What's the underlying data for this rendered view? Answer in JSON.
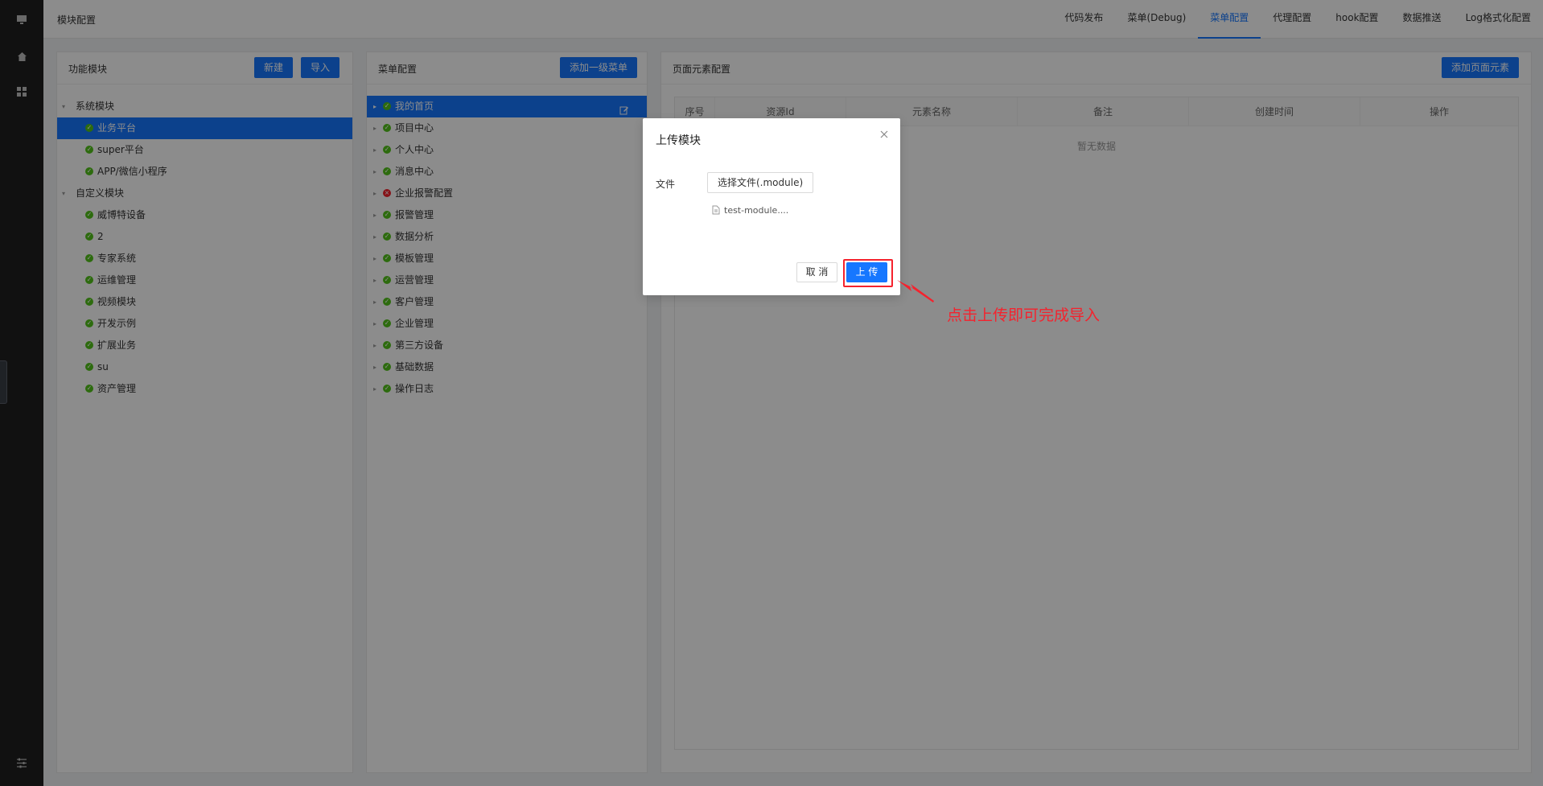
{
  "topbar": {
    "page_title": "模块配置",
    "tabs": [
      {
        "label": "代码发布",
        "active": false
      },
      {
        "label": "菜单(Debug)",
        "active": false
      },
      {
        "label": "菜单配置",
        "active": true
      },
      {
        "label": "代理配置",
        "active": false
      },
      {
        "label": "hook配置",
        "active": false
      },
      {
        "label": "数据推送",
        "active": false
      },
      {
        "label": "Log格式化配置",
        "active": false
      }
    ]
  },
  "sidebar": {
    "icons": [
      "monitor-icon",
      "home-icon",
      "grid-icon",
      "sliders-icon"
    ]
  },
  "module_panel": {
    "title": "功能模块",
    "new_label": "新建",
    "import_label": "导入",
    "groups": [
      {
        "label": "系统模块",
        "items": [
          "业务平台",
          "super平台",
          "APP/微信小程序"
        ]
      },
      {
        "label": "自定义模块",
        "items": [
          "威博特设备",
          "2",
          "专家系统",
          "运维管理",
          "视频模块",
          "开发示例",
          "扩展业务",
          "su",
          "资产管理"
        ]
      }
    ],
    "selected": "业务平台"
  },
  "menu_panel": {
    "title": "菜单配置",
    "add_label": "添加一级菜单",
    "items": [
      {
        "label": "我的首页",
        "status": "ok"
      },
      {
        "label": "项目中心",
        "status": "ok"
      },
      {
        "label": "个人中心",
        "status": "ok"
      },
      {
        "label": "消息中心",
        "status": "ok"
      },
      {
        "label": "企业报警配置",
        "status": "error"
      },
      {
        "label": "报警管理",
        "status": "ok"
      },
      {
        "label": "数据分析",
        "status": "ok"
      },
      {
        "label": "模板管理",
        "status": "ok"
      },
      {
        "label": "运营管理",
        "status": "ok"
      },
      {
        "label": "客户管理",
        "status": "ok"
      },
      {
        "label": "企业管理",
        "status": "ok"
      },
      {
        "label": "第三方设备",
        "status": "ok"
      },
      {
        "label": "基础数据",
        "status": "ok"
      },
      {
        "label": "操作日志",
        "status": "ok"
      }
    ],
    "selected": "我的首页"
  },
  "element_panel": {
    "title": "页面元素配置",
    "add_label": "添加页面元素",
    "columns": [
      "序号",
      "资源Id",
      "元素名称",
      "备注",
      "创建时间",
      "操作"
    ],
    "empty_text": "暂无数据"
  },
  "modal": {
    "title": "上传模块",
    "file_label": "文件",
    "choose_file_label": "选择文件(.module)",
    "file_name": "test-module....",
    "cancel_label": "取 消",
    "upload_label": "上 传"
  },
  "annotation": {
    "text": "点击上传即可完成导入",
    "color": "#f5222d"
  },
  "colors": {
    "primary": "#1677ff",
    "success": "#52c41a",
    "error": "#f5222d",
    "sidebar": "#1f1f1f"
  }
}
